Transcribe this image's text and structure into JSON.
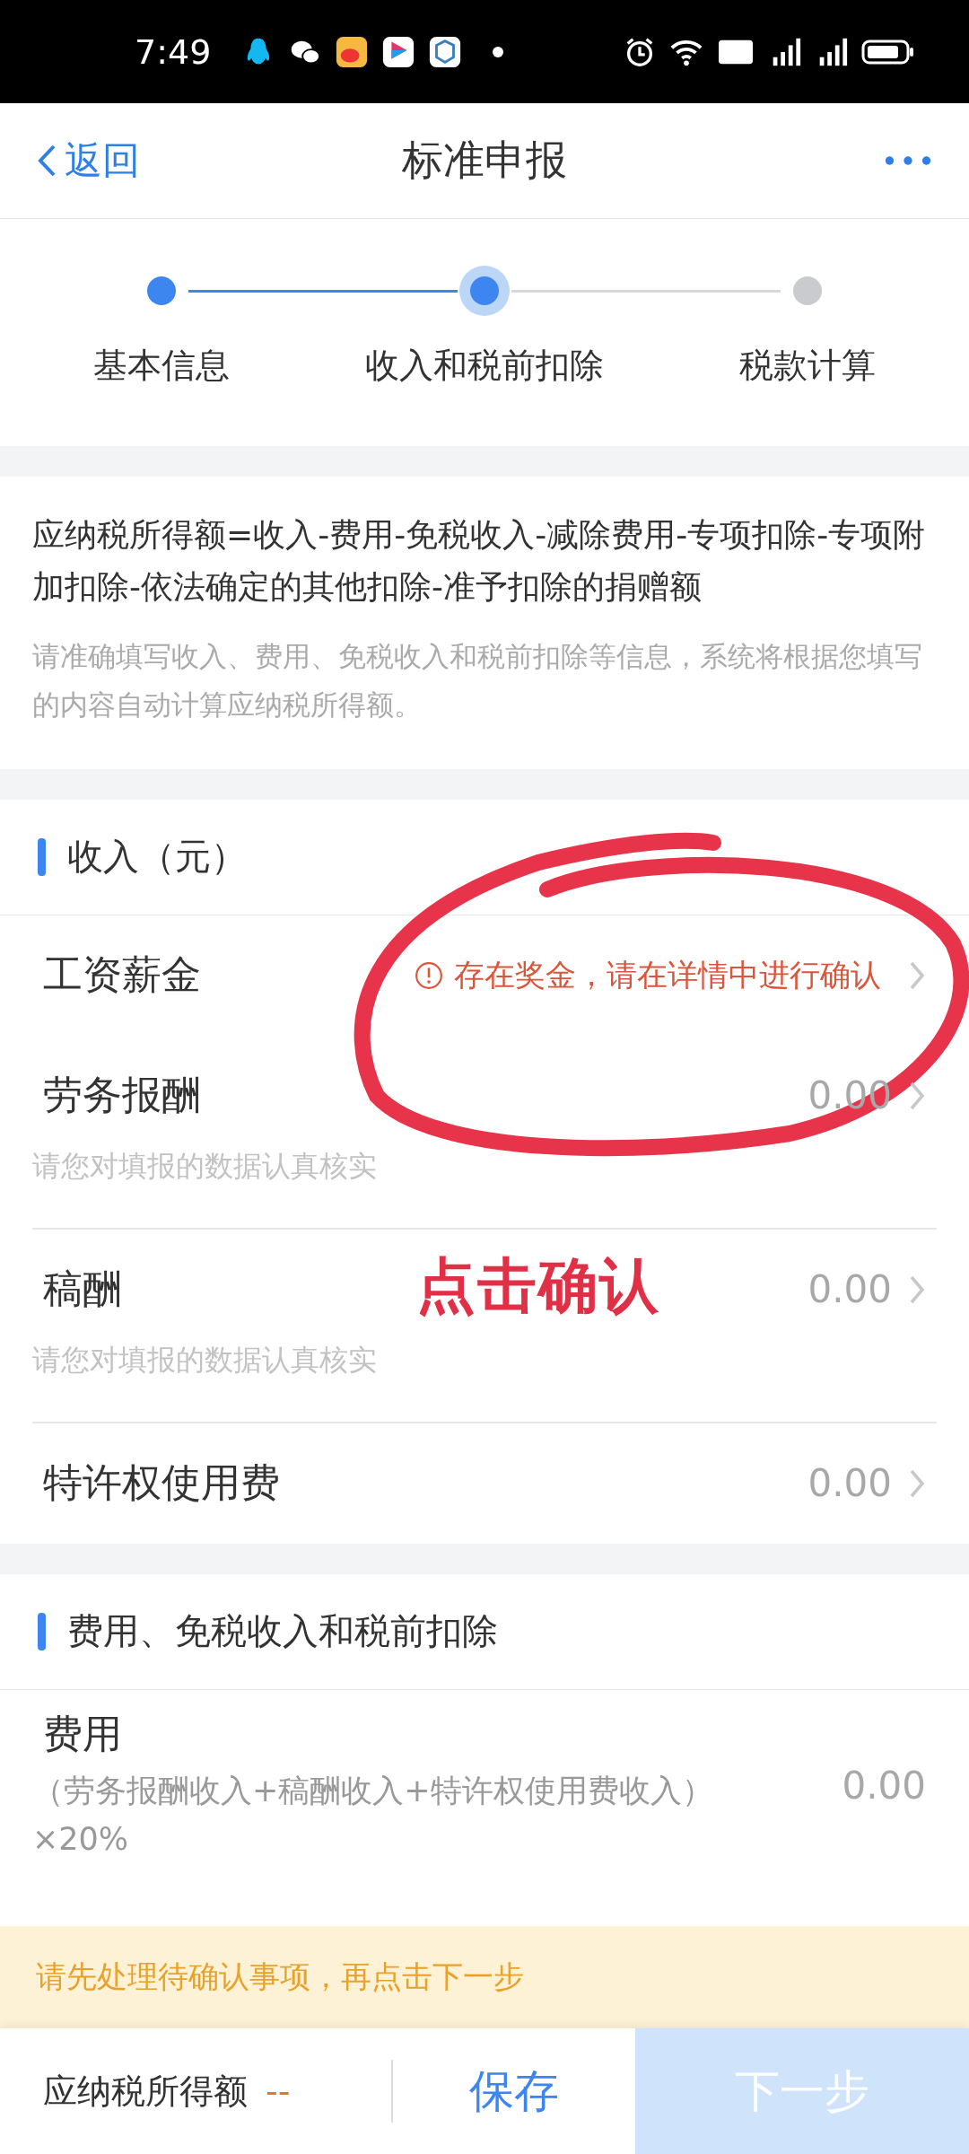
{
  "status_bar": {
    "time": "7:49"
  },
  "nav": {
    "back": "返回",
    "title": "标准申报"
  },
  "steps": [
    {
      "label": "基本信息",
      "kind": "done"
    },
    {
      "label": "收入和税前扣除",
      "kind": "current"
    },
    {
      "label": "税款计算",
      "kind": "pending"
    }
  ],
  "intro": {
    "formula": "应纳税所得额=收入-费用-免税收入-减除费用-专项扣除-专项附加扣除-依法确定的其他扣除-准予扣除的捐赠额",
    "note": "请准确填写收入、费用、免税收入和税前扣除等信息，系统将根据您填写的内容自动计算应纳税所得额。"
  },
  "income": {
    "title": "收入（元）",
    "rows": [
      {
        "label": "工资薪金",
        "warning": "存在奖金，请在详情中进行确认"
      },
      {
        "label": "劳务报酬",
        "value": "0.00",
        "hint": "请您对填报的数据认真核实"
      },
      {
        "label": "稿酬",
        "value": "0.00",
        "hint": "请您对填报的数据认真核实"
      },
      {
        "label": "特许权使用费",
        "value": "0.00"
      }
    ]
  },
  "expenses": {
    "title": "费用、免税收入和税前扣除",
    "rows": [
      {
        "label": "费用",
        "sublabel": "（劳务报酬收入+稿酬收入+特许权使用费收入）×20%",
        "value": "0.00"
      }
    ]
  },
  "banner": "请先处理待确认事项，再点击下一步",
  "bottom_bar": {
    "label": "应纳税所得额",
    "value": "--",
    "save": "保存",
    "next": "下一步",
    "next_disabled": true
  },
  "annotation": {
    "text": "点击确认"
  }
}
